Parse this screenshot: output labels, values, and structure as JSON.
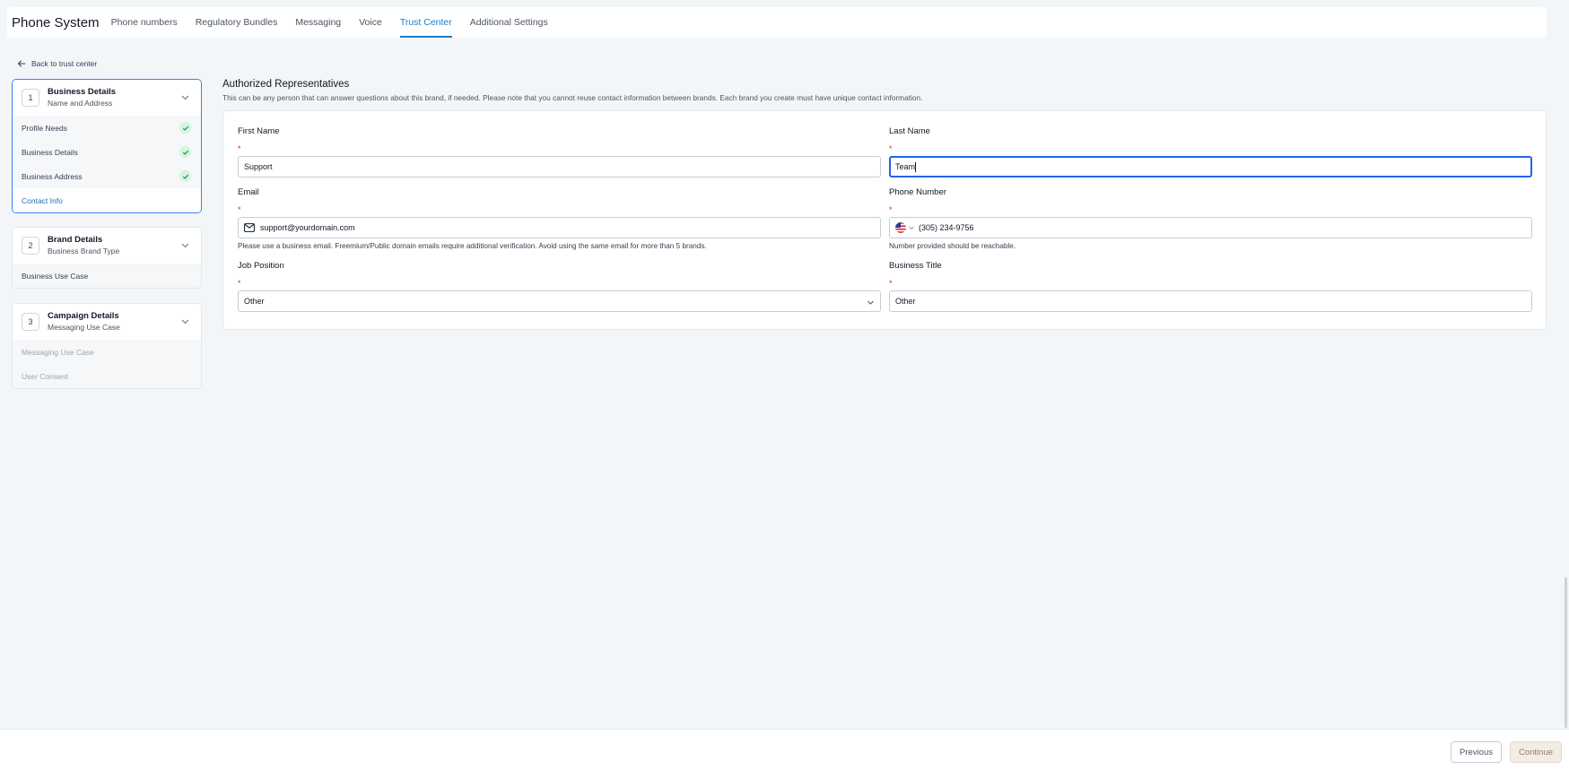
{
  "header": {
    "app_title": "Phone System",
    "tabs": [
      {
        "label": "Phone numbers",
        "active": false
      },
      {
        "label": "Regulatory Bundles",
        "active": false
      },
      {
        "label": "Messaging",
        "active": false
      },
      {
        "label": "Voice",
        "active": false
      },
      {
        "label": "Trust Center",
        "active": true
      },
      {
        "label": "Additional Settings",
        "active": false
      }
    ]
  },
  "back_link": {
    "label": "Back to trust center"
  },
  "steps": [
    {
      "number": "1",
      "title": "Business Details",
      "subtitle": "Name and Address",
      "items": [
        {
          "label": "Profile Needs",
          "status": "complete"
        },
        {
          "label": "Business Details",
          "status": "complete"
        },
        {
          "label": "Business Address",
          "status": "complete"
        },
        {
          "label": "Contact Info",
          "status": "current"
        }
      ]
    },
    {
      "number": "2",
      "title": "Brand Details",
      "subtitle": "Business Brand Type",
      "items": [
        {
          "label": "Business Use Case",
          "status": "pending"
        }
      ]
    },
    {
      "number": "3",
      "title": "Campaign Details",
      "subtitle": "Messaging Use Case",
      "items": [
        {
          "label": "Messaging Use Case",
          "status": "disabled"
        },
        {
          "label": "User Consent",
          "status": "disabled"
        }
      ]
    }
  ],
  "section": {
    "title": "Authorized Representatives",
    "description": "This can be any person that can answer questions about this brand, if needed. Please note that you cannot reuse contact information between brands. Each brand you create must have unique contact information."
  },
  "form": {
    "required_mark": "*",
    "first_name": {
      "label": "First Name",
      "value": "Support"
    },
    "last_name": {
      "label": "Last Name",
      "value": "Team"
    },
    "email": {
      "label": "Email",
      "value": "support@yourdomain.com",
      "helper": "Please use a business email. Freemium/Public domain emails require additional verification. Avoid using the same email for more than 5 brands."
    },
    "phone": {
      "label": "Phone Number",
      "country": "US",
      "value": "(305) 234-9756",
      "helper": "Number provided should be reachable."
    },
    "job_position": {
      "label": "Job Position",
      "value": "Other"
    },
    "business_title": {
      "label": "Business Title",
      "value": "Other"
    }
  },
  "footer": {
    "previous_label": "Previous",
    "continue_label": "Continue"
  },
  "colors": {
    "accent": "#1d7ec7",
    "focus": "#2563eb",
    "required": "#dc2626",
    "success_bg": "#d6f5e1",
    "success_check": "#16a34a",
    "background": "#f2f6f8"
  }
}
